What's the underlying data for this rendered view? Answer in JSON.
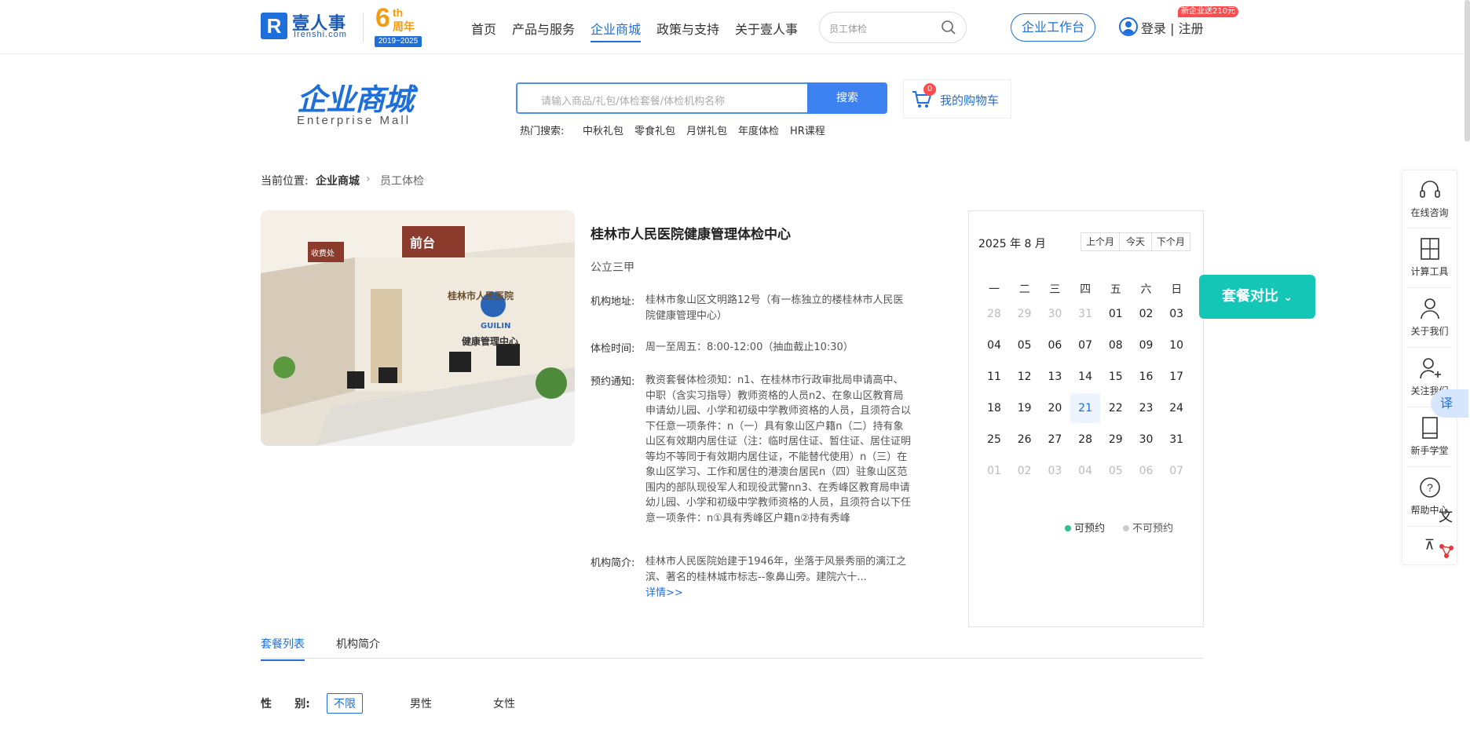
{
  "header": {
    "logo_letter": "R",
    "logo_name": "壹人事",
    "logo_domain": "Irenshi.com",
    "anniversary_number": "6",
    "anniversary_suffix": "th",
    "anniversary_text": "周年",
    "anniversary_years": "2019~2025",
    "nav": [
      "首页",
      "产品与服务",
      "企业商城",
      "政策与支持",
      "关于壹人事"
    ],
    "active_nav": "企业商城",
    "search_placeholder": "员工体检",
    "workbench_label": "企业工作台",
    "login_label": "登录 | 注册",
    "promo_badge": "新企业送210元"
  },
  "mall": {
    "title": "企业商城",
    "subtitle": "Enterprise Mall",
    "search_placeholder": "请输入商品/礼包/体检套餐/体检机构名称",
    "search_button": "搜索",
    "cart_count": "0",
    "cart_label": "我的购物车",
    "hot_label": "热门搜索:",
    "hot_items": [
      "中秋礼包",
      "零食礼包",
      "月饼礼包",
      "年度体检",
      "HR课程"
    ]
  },
  "breadcrumb": {
    "prefix": "当前位置:",
    "items": [
      "企业商城",
      "员工体检"
    ]
  },
  "institution": {
    "name": "桂林市人民医院健康管理体检中心",
    "level": "公立三甲",
    "address_label": "机构地址:",
    "address": "桂林市象山区文明路12号（有一栋独立的楼桂林市人民医院健康管理中心）",
    "hours_label": "体检时间:",
    "hours": "周一至周五：8:00-12:00（抽血截止10:30）",
    "notice_label": "预约通知:",
    "notice": "教资套餐体检须知：n1、在桂林市行政审批局申请高中、中职（含实习指导）教师资格的人员n2、在象山区教育局申请幼儿园、小学和初级中学教师资格的人员，且须符合以下任意一项条件：n（一）具有象山区户籍n（二）持有象山区有效期内居住证（注：临时居住证、暂住证、居住证明等均不等同于有效期内居住证，不能替代使用）n（三）在象山区学习、工作和居住的港澳台居民n（四）驻象山区范围内的部队现役军人和现役武警nn3、在秀峰区教育局申请幼儿园、小学和初级中学教师资格的人员，且须符合以下任意一项条件：n①具有秀峰区户籍n②持有秀峰",
    "intro_label": "机构简介:",
    "intro": "桂林市人民医院始建于1946年，坐落于风景秀丽的漓江之滨、著名的桂林城市标志--象鼻山旁。建院六十...",
    "more_link": "详情>>",
    "photo_sign": "前台",
    "photo_logo": "GUILIN",
    "photo_hospital": "桂林市人民医院",
    "photo_center": "健康管理中心",
    "photo_small_sign": "收费处"
  },
  "calendar": {
    "month_label": "2025 年 8 月",
    "prev_label": "上个月",
    "today_label": "今天",
    "next_label": "下个月",
    "weekdays": [
      "一",
      "二",
      "三",
      "四",
      "五",
      "六",
      "日"
    ],
    "days": [
      [
        "28",
        "29",
        "30",
        "31",
        "01",
        "02",
        "03"
      ],
      [
        "04",
        "05",
        "06",
        "07",
        "08",
        "09",
        "10"
      ],
      [
        "11",
        "12",
        "13",
        "14",
        "15",
        "16",
        "17"
      ],
      [
        "18",
        "19",
        "20",
        "21",
        "22",
        "23",
        "24"
      ],
      [
        "25",
        "26",
        "27",
        "28",
        "29",
        "30",
        "31"
      ],
      [
        "01",
        "02",
        "03",
        "04",
        "05",
        "06",
        "07"
      ]
    ],
    "today": "21",
    "legend_available": "可预约",
    "legend_unavailable": "不可预约",
    "available_color": "#2bc48a",
    "unavailable_color": "#cccccc"
  },
  "compare_button": "套餐对比",
  "sidebar": {
    "items": [
      "在线咨询",
      "计算工具",
      "关于我们",
      "关注我们",
      "新手学堂",
      "帮助中心"
    ],
    "translate_label": "译"
  },
  "tabs": [
    "套餐列表",
    "机构简介"
  ],
  "filter": {
    "label": "性      别:",
    "options": [
      "不限",
      "男性",
      "女性"
    ]
  },
  "colors": {
    "primary": "#1e6fd9",
    "compare": "#14c6b5",
    "badge": "#ff4d4f"
  }
}
